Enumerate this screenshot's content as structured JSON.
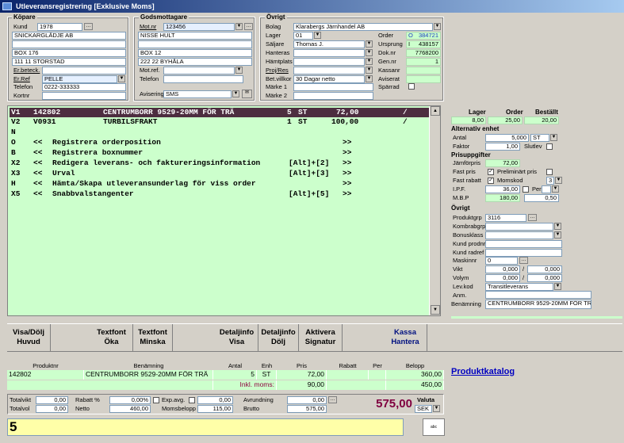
{
  "window": {
    "title": "Utleveransregistrering [Exklusive Moms]"
  },
  "kopare": {
    "title": "Köpare",
    "kund_label": "Kund",
    "kund": "1978",
    "name": "SNICKARGLÄDJE AB",
    "address1": "",
    "address2": "BOX 176",
    "city": "111 11   STORSTAD",
    "erbeteck_label": "Er.beteck.",
    "erbeteck": "",
    "erref_label": "Er.Ref",
    "erref": "PELLE",
    "telefon_label": "Telefon",
    "telefon": "0222-333333",
    "kortnr_label": "Kortnr",
    "kortnr": ""
  },
  "godsmottagare": {
    "title": "Godsmottagare",
    "motnr_label": "Mot.nr",
    "motnr": "123456",
    "name": "NISSE HULT",
    "address1": "",
    "address2": "BOX 12",
    "city": "222 22   BYHÅLA",
    "motref_label": "Mot.ref.",
    "motref": "",
    "telefon_label": "Telefon",
    "telefon": "",
    "avisering_label": "Avisering",
    "avisering": "SMS"
  },
  "ovrigt": {
    "title": "Övrigt",
    "bolag_label": "Bolag",
    "bolag": "Klarabergs  Järnhandel AB",
    "lager_label": "Lager",
    "lager": "01",
    "saljare_label": "Säljare",
    "saljare": "Thomas J.",
    "hanteras_label": "Hanteras",
    "hanteras": "",
    "hamtplats_label": "Hämtplats",
    "hamtplats": "",
    "projres_label": "Proj/Res",
    "projres": "",
    "betvillkor_label": "Bet.villkor",
    "betvillkor": "30 Dagar netto",
    "marke1_label": "Märke 1",
    "marke1": "",
    "marke2_label": "Märke 2",
    "marke2": "",
    "order_label": "Order",
    "order_flag": "O",
    "order": "384721",
    "ursprung_label": "Ursprung",
    "ursprung_flag": "I",
    "ursprung": "438157",
    "doknr_label": "Dok.nr",
    "doknr": "7768200",
    "gennr_label": "Gen.nr",
    "gennr": "1",
    "kassanr_label": "Kassanr",
    "kassanr": "",
    "aviserat_label": "Aviserat",
    "aviserat": "",
    "sparrad_label": "Spärrad"
  },
  "lines": [
    {
      "code": "V1",
      "prod": "142802",
      "desc": "CENTRUMBORR 9529-20MM FÖR TRÄ",
      "qty": "5",
      "unit": "ST",
      "price": "72,00",
      "mark": "/"
    },
    {
      "code": "V2",
      "prod": "V0931",
      "desc": "TURBILSFRAKT",
      "qty": "1",
      "unit": "ST",
      "price": "100,00",
      "mark": "/"
    }
  ],
  "menu": [
    {
      "key": "N",
      "text": "",
      "hot": "",
      "arrow": ""
    },
    {
      "key": "O",
      "text": "Registrera orderposition",
      "hot": "",
      "arrow": ">>"
    },
    {
      "key": "B",
      "text": "Registrera boxnummer",
      "hot": "",
      "arrow": ">>"
    },
    {
      "key": "X2",
      "text": "Redigera leverans- och faktureringsinformation",
      "hot": "[Alt]+[2]",
      "arrow": ">>"
    },
    {
      "key": "X3",
      "text": "Urval",
      "hot": "[Alt]+[3]",
      "arrow": ">>"
    },
    {
      "key": "H",
      "text": "Hämta/Skapa utleveransunderlag för viss order",
      "hot": "",
      "arrow": ">>"
    },
    {
      "key": "X5",
      "text": "Snabbvalstangenter",
      "hot": "[Alt]+[5]",
      "arrow": ">>"
    }
  ],
  "menu_prefix": "<<",
  "side": {
    "lager_h": "Lager",
    "order_h": "Order",
    "bestallt_h": "Beställt",
    "lager": "8,00",
    "order": "25,00",
    "bestallt": "20,00",
    "alt_title": "Alternativ enhet",
    "antal_label": "Antal",
    "antal": "5,000",
    "antal_unit": "ST",
    "faktor_label": "Faktor",
    "faktor": "1,00",
    "slutlev_label": "Slutlev",
    "pris_title": "Prisuppgifter",
    "jamfor_label": "Jämförpris",
    "jamfor": "72,00",
    "fastpris_label": "Fast pris",
    "prelpris_label": "Preliminärt pris",
    "fastrabatt_label": "Fast rabatt",
    "momskod_label": "Momskod",
    "momskod": "3",
    "ipf_label": "I.P.F.",
    "ipf": "36,00",
    "per_label": "Per",
    "mbp_label": "M.B.P",
    "mbp": "180,00",
    "mbp2": "0,50",
    "ovr_title": "Övrigt",
    "produktgrp_label": "Produktgrp",
    "produktgrp": "3116",
    "kombrabgrp_label": "Kombrabgrp",
    "bonusklass_label": "Bonusklass",
    "kundprodnr_label": "Kund prodnr",
    "kundradref_label": "Kund radref",
    "maskinnr_label": "Maskinnr",
    "maskinnr": "0",
    "vikt_label": "Vikt",
    "vikt1": "0,000",
    "vikt2": "0,000",
    "volym_label": "Volym",
    "volym1": "0,000",
    "volym2": "0,000",
    "slash": "/",
    "levkod_label": "Lev.kod",
    "levkod": "Transitleverans",
    "anm_label": "Anm.",
    "benamning_label": "Benämning",
    "benamning": "CENTRUMBORR 9529-20MM FÖR TRÄ"
  },
  "buttons": [
    {
      "line1": "Visa/Dölj",
      "line2": "Huvud"
    },
    {
      "line1": "Textfont",
      "line2": "Öka"
    },
    {
      "line1": "Textfont",
      "line2": "Minska"
    },
    {
      "line1": "Detaljinfo",
      "line2": "Visa"
    },
    {
      "line1": "Detaljinfo",
      "line2": "Dölj"
    },
    {
      "line1": "Aktivera",
      "line2": "Signatur"
    },
    {
      "line1": "Kassa",
      "line2": "Hantera"
    }
  ],
  "table": {
    "headers": [
      "Produktnr",
      "Benämning",
      "Antal",
      "Enh",
      "Pris",
      "Rabatt",
      "Per",
      "Belopp"
    ],
    "row": [
      "142802",
      "CENTRUMBORR 9529-20MM FÖR TRÄ",
      "5",
      "ST",
      "72,00",
      "",
      "",
      "360,00"
    ],
    "inkl_label": "Inkl. moms:",
    "inkl_pris": "90,00",
    "inkl_belopp": "450,00"
  },
  "produktkatalog": "Produktkatalog",
  "totals": {
    "totalvikt_label": "Totalvikt",
    "totalvikt": "0,00",
    "totalvol_label": "Totalvol",
    "totalvol": "0,00",
    "rabatt_label": "Rabatt %",
    "rabatt": "0,00%",
    "netto_label": "Netto",
    "netto": "460,00",
    "expavg_label": "Exp.avg.",
    "expavg": "0,00",
    "momsbelopp_label": "Momsbelopp",
    "momsbelopp": "115,00",
    "avrundning_label": "Avrundning",
    "avrundning": "0,00",
    "brutto_label": "Brutto",
    "brutto": "575,00",
    "total": "575,00",
    "valuta_label": "Valuta",
    "valuta": "SEK"
  },
  "command": {
    "value": "5"
  },
  "abc_label": "abc"
}
